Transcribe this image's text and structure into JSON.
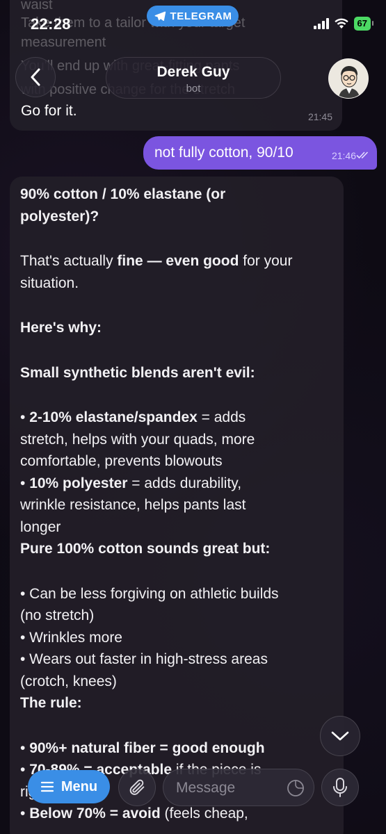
{
  "status_bar": {
    "time": "22:28",
    "app_pill": "TELEGRAM",
    "battery": "67"
  },
  "header": {
    "name": "Derek Guy",
    "subtitle": "bot"
  },
  "messages": {
    "prev_incoming": {
      "ghost_lines": [
        "waist",
        "Take them to a tailor with your target",
        "measurement",
        "You'll end up with great-fitting pants",
        "with positive change for the stretch"
      ],
      "text": "Go for it.",
      "time": "21:45"
    },
    "outgoing": {
      "text": "not fully cotton, 90/10",
      "time": "21:46"
    },
    "incoming": {
      "lines": [
        {
          "segs": [
            {
              "t": "90% cotton / 10% elastane (or",
              "b": true
            }
          ]
        },
        {
          "segs": [
            {
              "t": "polyester)?",
              "b": true
            }
          ]
        },
        {
          "blank": true
        },
        {
          "segs": [
            {
              "t": "That's actually ",
              "b": false
            },
            {
              "t": "fine — even good",
              "b": true
            },
            {
              "t": " for your",
              "b": false
            }
          ]
        },
        {
          "segs": [
            {
              "t": "situation.",
              "b": false
            }
          ]
        },
        {
          "blank": true
        },
        {
          "segs": [
            {
              "t": "Here's why:",
              "b": true
            }
          ]
        },
        {
          "blank": true
        },
        {
          "segs": [
            {
              "t": "Small synthetic blends aren't evil:",
              "b": true
            }
          ]
        },
        {
          "blank": true
        },
        {
          "segs": [
            {
              "t": "• ",
              "b": false
            },
            {
              "t": "2-10% elastane/spandex",
              "b": true
            },
            {
              "t": " = adds",
              "b": false
            }
          ]
        },
        {
          "segs": [
            {
              "t": "stretch, helps with your quads, more",
              "b": false
            }
          ]
        },
        {
          "segs": [
            {
              "t": "comfortable, prevents blowouts",
              "b": false
            }
          ]
        },
        {
          "segs": [
            {
              "t": "• ",
              "b": false
            },
            {
              "t": "10% polyester",
              "b": true
            },
            {
              "t": " = adds durability,",
              "b": false
            }
          ]
        },
        {
          "segs": [
            {
              "t": "wrinkle resistance, helps pants last",
              "b": false
            }
          ]
        },
        {
          "segs": [
            {
              "t": "longer",
              "b": false
            }
          ]
        },
        {
          "segs": [
            {
              "t": "Pure 100% cotton sounds great but:",
              "b": true
            }
          ]
        },
        {
          "blank": true
        },
        {
          "segs": [
            {
              "t": "• Can be less forgiving on athletic builds",
              "b": false
            }
          ]
        },
        {
          "segs": [
            {
              "t": "(no stretch)",
              "b": false
            }
          ]
        },
        {
          "segs": [
            {
              "t": "• Wrinkles more",
              "b": false
            }
          ]
        },
        {
          "segs": [
            {
              "t": "• Wears out faster in high-stress areas",
              "b": false
            }
          ]
        },
        {
          "segs": [
            {
              "t": "(crotch, knees)",
              "b": false
            }
          ]
        },
        {
          "segs": [
            {
              "t": "The rule:",
              "b": true
            }
          ]
        },
        {
          "blank": true
        },
        {
          "segs": [
            {
              "t": "• ",
              "b": false
            },
            {
              "t": "90%+ natural fiber = good enough",
              "b": true
            }
          ]
        },
        {
          "segs": [
            {
              "t": "• ",
              "b": false
            },
            {
              "t": "70-89% = acceptable",
              "b": true
            },
            {
              "t": " if the piece is",
              "b": false
            }
          ]
        },
        {
          "segs": [
            {
              "t": "right",
              "b": false
            }
          ]
        },
        {
          "segs": [
            {
              "t": "• ",
              "b": false
            },
            {
              "t": "Below 70% = avoid",
              "b": true
            },
            {
              "t": " (feels cheap,",
              "b": false
            }
          ]
        }
      ]
    }
  },
  "input_bar": {
    "menu_label": "Menu",
    "placeholder": "Message"
  },
  "colors": {
    "accent_blue": "#3a8ee6",
    "outgoing_bubble": "#7b55e0",
    "incoming_bubble": "#221e28"
  }
}
